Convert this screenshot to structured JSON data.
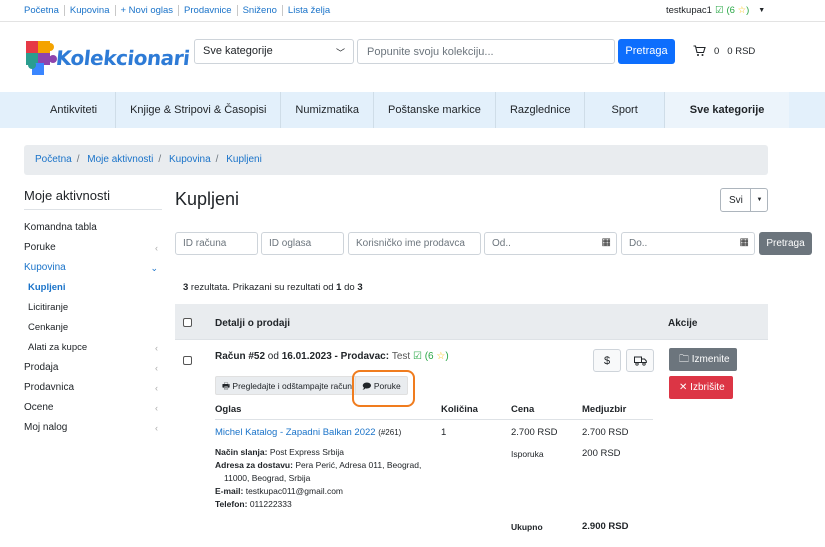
{
  "topbar": {
    "links": [
      "Početna",
      "Kupovina",
      "+ Novi oglas",
      "Prodavnice",
      "Sniženo",
      "Lista želja"
    ],
    "user": "testkupac1",
    "rating": "(6",
    "rating_end": ")"
  },
  "header": {
    "logo_text": "Kolekcionari",
    "category_select": "Sve kategorije",
    "search_placeholder": "Popunite svoju kolekciju...",
    "search_button": "Pretraga",
    "cart_count": "0",
    "cart_amount": "0 RSD"
  },
  "categories": [
    "Antikviteti",
    "Knjige & Stripovi & Časopisi",
    "Numizmatika",
    "Poštanske markice",
    "Razglednice",
    "Sport",
    "Sve kategorije"
  ],
  "breadcrumb": [
    "Početna",
    "Moje aktivnosti",
    "Kupovina",
    "Kupljeni"
  ],
  "sidebar": {
    "title": "Moje aktivnosti",
    "items": [
      "Komandna tabla",
      "Poruke",
      "Kupovina",
      "Kupljeni",
      "Licitiranje",
      "Cenkanje",
      "Alati za kupce",
      "Prodaja",
      "Prodavnica",
      "Ocene",
      "Moj nalog"
    ]
  },
  "page": {
    "title": "Kupljeni",
    "view_select": "Svi"
  },
  "filters": {
    "invoice_id": "ID računa",
    "ad_id": "ID oglasa",
    "seller": "Korisničko ime prodavca",
    "from": "Od..",
    "to": "Do..",
    "button": "Pretraga"
  },
  "results": {
    "count": "3",
    "text1": " rezultata. Prikazani su rezultati od ",
    "from": "1",
    "text2": " do ",
    "to": "3"
  },
  "table": {
    "col_details": "Detalji o prodaji",
    "col_actions": "Akcije"
  },
  "order": {
    "invoice_label": "Račun #52",
    "from_word": " od ",
    "date": "16.01.2023",
    "seller_label": " - Prodavac: ",
    "seller": "Test",
    "rating": "(6",
    "rating_end": ")",
    "print_button": "Pregledajte i odštampajte račun",
    "messages_button": "Poruke",
    "col_ad": "Oglas",
    "col_qty": "Količina",
    "col_price": "Cena",
    "col_subtotal": "Medjuzbir",
    "item_title": "Michel Katalog - Zapadni Balkan 2022",
    "item_id": "(#261)",
    "qty": "1",
    "price": "2.700 RSD",
    "subtotal": "2.700 RSD",
    "shipping_label": "Isporuka",
    "shipping": "200 RSD",
    "delivery_method_label": "Način slanja:",
    "delivery_method": "Post Express Srbija",
    "address_label": "Adresa za dostavu:",
    "address_line1": "Pera Perić, Adresa 011, Beograd,",
    "address_line2": "11000, Beograd, Srbija",
    "email_label": "E-mail:",
    "email": "testkupac011@gmail.com",
    "phone_label": "Telefon:",
    "phone": "011222333",
    "total_label": "Ukupno",
    "total": "2.900 RSD",
    "edit_button": "Izmenite",
    "delete_button": "Izbrišite"
  },
  "colors": {
    "primary": "#0d6efd",
    "link": "#1a73c9",
    "danger": "#dc3545",
    "secondary": "#6c757d",
    "highlight": "#f07c1e",
    "nav_bg": "#e3f0fb"
  }
}
